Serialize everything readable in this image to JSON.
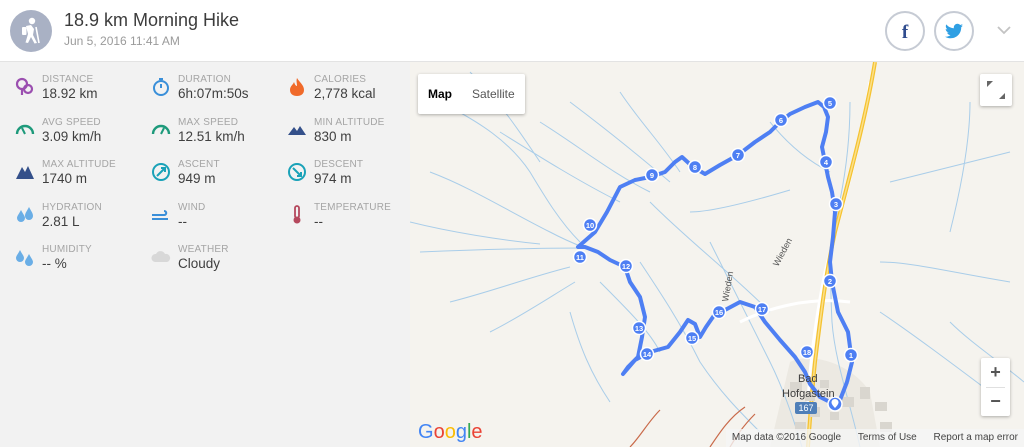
{
  "header": {
    "title": "18.9 km Morning Hike",
    "subtitle": "Jun 5, 2016 11:41 AM",
    "facebook_label": "f",
    "twitter_label": "twitter"
  },
  "colors": {
    "route": "#4e7ff3",
    "accent_purple": "#9b59b6",
    "accent_green": "#1e9a7b",
    "accent_orange": "#f06a2a",
    "accent_blue": "#3498db",
    "accent_navy": "#34508a",
    "accent_teal": "#1aa2b8",
    "accent_red": "#b5485d"
  },
  "stats": [
    {
      "label": "DISTANCE",
      "value": "18.92 km",
      "icon": "distance-icon"
    },
    {
      "label": "DURATION",
      "value": "6h:07m:50s",
      "icon": "stopwatch-icon"
    },
    {
      "label": "CALORIES",
      "value": "2,778 kcal",
      "icon": "flame-icon"
    },
    {
      "label": "AVG SPEED",
      "value": "3.09 km/h",
      "icon": "speedometer-icon"
    },
    {
      "label": "MAX SPEED",
      "value": "12.51 km/h",
      "icon": "speedometer-icon"
    },
    {
      "label": "MIN ALTITUDE",
      "value": "830 m",
      "icon": "mountain-icon"
    },
    {
      "label": "MAX ALTITUDE",
      "value": "1740 m",
      "icon": "mountain-icon"
    },
    {
      "label": "ASCENT",
      "value": "949 m",
      "icon": "ascent-icon"
    },
    {
      "label": "DESCENT",
      "value": "974 m",
      "icon": "descent-icon"
    },
    {
      "label": "HYDRATION",
      "value": "2.81 L",
      "icon": "water-drop-icon"
    },
    {
      "label": "WIND",
      "value": "--",
      "icon": "wind-icon"
    },
    {
      "label": "TEMPERATURE",
      "value": "--",
      "icon": "thermometer-icon"
    },
    {
      "label": "HUMIDITY",
      "value": "-- %",
      "icon": "humidity-icon"
    },
    {
      "label": "WEATHER",
      "value": "Cloudy",
      "icon": "cloud-icon"
    }
  ],
  "map": {
    "tab_map": "Map",
    "tab_satellite": "Satellite",
    "zoom_in": "+",
    "zoom_out": "−",
    "google_logo": "Google",
    "attribution": "Map data ©2016 Google",
    "terms": "Terms of Use",
    "report": "Report a map error",
    "place_label_1": "Bad",
    "place_label_2": "Hofgastein",
    "road_label": "Wieden",
    "road_label_2": "Wieden",
    "road_shield": "167",
    "markers": [
      "1",
      "2",
      "3",
      "4",
      "5",
      "6",
      "7",
      "8",
      "9",
      "10",
      "11",
      "12",
      "13",
      "14",
      "15",
      "16",
      "17",
      "18"
    ]
  }
}
